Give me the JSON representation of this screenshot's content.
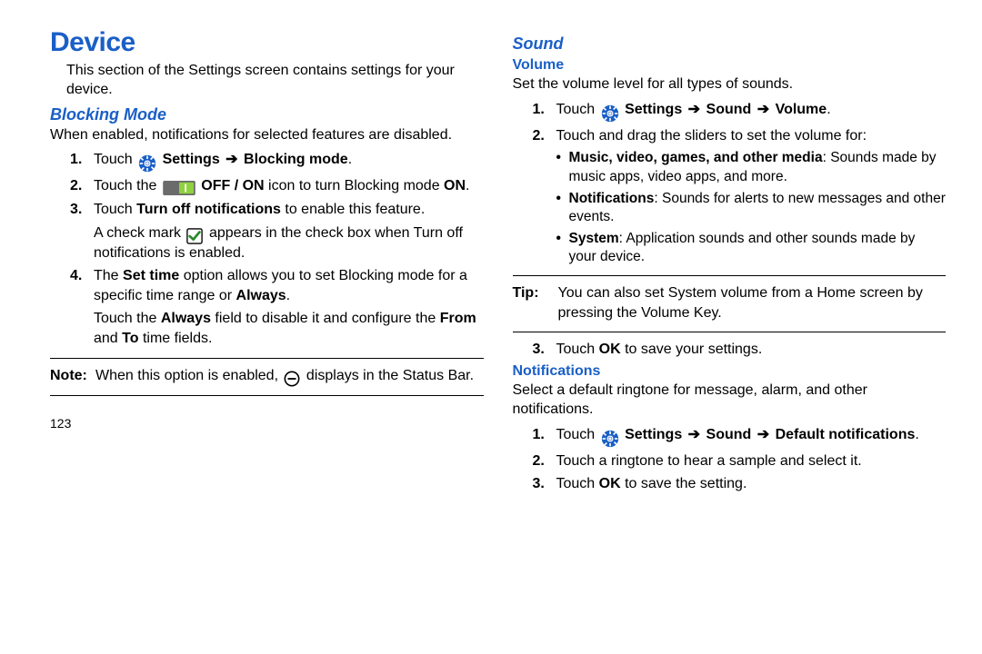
{
  "page_number": "123",
  "left": {
    "h1": "Device",
    "intro": "This section of the Settings screen contains settings for your device.",
    "blocking": {
      "heading": "Blocking Mode",
      "intro": "When enabled, notifications for selected features are disabled.",
      "step1_pre": "Touch ",
      "step1_boldA": "Settings",
      "step1_arrow": " ➔ ",
      "step1_boldB": "Blocking mode",
      "step1_post": ".",
      "step2_pre": "Touch the ",
      "step2_mid_bold": "OFF / ON",
      "step2_mid_plain": " icon to turn Blocking mode ",
      "step2_end_bold": "ON",
      "step2_end_plain": ".",
      "step3_pre": "Touch ",
      "step3_bold": "Turn off notifications",
      "step3_post": " to enable this feature.",
      "step3_sub_pre": "A check mark ",
      "step3_sub_post": " appears in the check box when Turn off notifications is enabled.",
      "step4_pre": "The ",
      "step4_bold1": "Set time",
      "step4_mid": " option allows you to set Blocking mode for a specific time range or ",
      "step4_bold2": "Always",
      "step4_post": ".",
      "step4_sub_pre": "Touch the ",
      "step4_sub_bold1": "Always",
      "step4_sub_mid1": " field to disable it and configure the ",
      "step4_sub_bold2": "From",
      "step4_sub_mid2": " and ",
      "step4_sub_bold3": "To",
      "step4_sub_post": " time fields.",
      "note_label": "Note:",
      "note_pre": " When this option is enabled, ",
      "note_post": " displays in the Status Bar."
    }
  },
  "right": {
    "sound_heading": "Sound",
    "volume": {
      "heading": "Volume",
      "intro": "Set the volume level for all types of sounds.",
      "step1_pre": "Touch ",
      "step1_boldA": "Settings",
      "step1_arrowA": " ➔ ",
      "step1_boldB": "Sound",
      "step1_arrowB": " ➔ ",
      "step1_boldC": "Volume",
      "step1_post": ".",
      "step2": "Touch and drag the sliders to set the volume for:",
      "b1_bold": "Music, video, games, and other media",
      "b1_rest": ": Sounds made by music apps, video apps, and more.",
      "b2_bold": "Notifications",
      "b2_rest": ": Sounds for alerts to new messages and other events.",
      "b3_bold": "System",
      "b3_rest": ": Application sounds and other sounds made by your device.",
      "tip_label": "Tip:",
      "tip_body": " You can also set System volume from a Home screen by pressing the Volume Key.",
      "step3_pre": "Touch ",
      "step3_bold": "OK",
      "step3_post": " to save your settings."
    },
    "notif": {
      "heading": "Notifications",
      "intro": "Select a default ringtone for message, alarm, and other notifications.",
      "step1_pre": "Touch ",
      "step1_boldA": "Settings",
      "step1_arrowA": " ➔ ",
      "step1_boldB": "Sound",
      "step1_arrowB": " ➔ ",
      "step1_boldC": "Default notifications",
      "step1_post": ".",
      "step2": "Touch a ringtone to hear a sample and select it.",
      "step3_pre": "Touch ",
      "step3_bold": "OK",
      "step3_post": " to save the setting."
    }
  }
}
